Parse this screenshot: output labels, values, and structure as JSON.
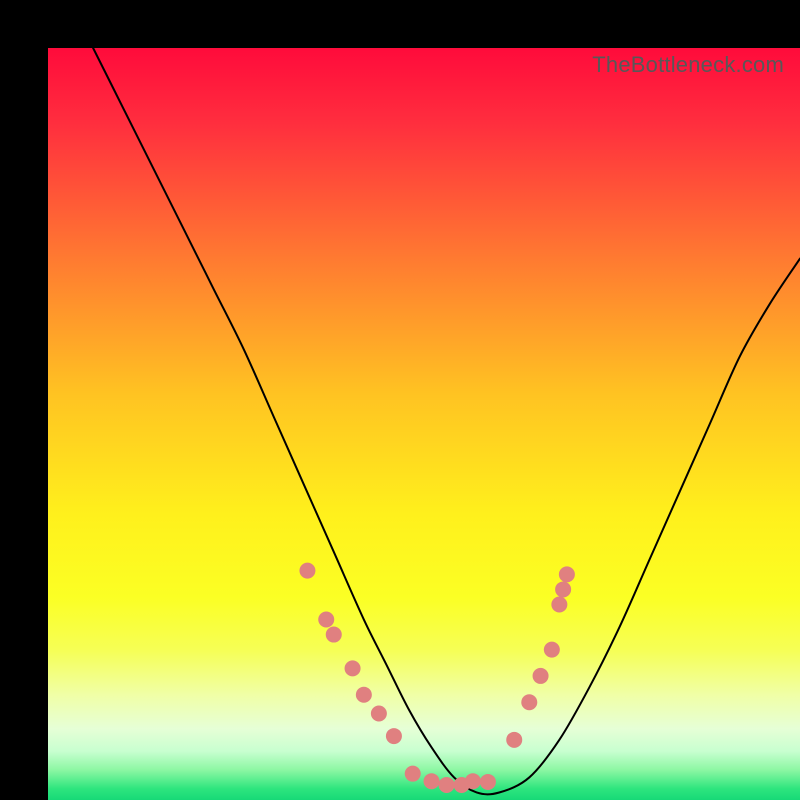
{
  "watermark": "TheBottleneck.com",
  "chart_data": {
    "type": "line",
    "title": "",
    "xlabel": "",
    "ylabel": "",
    "xlim": [
      0,
      100
    ],
    "ylim": [
      0,
      100
    ],
    "grid": false,
    "legend": false,
    "background": {
      "type": "vertical-gradient",
      "stops": [
        {
          "pos": 0.0,
          "color": "#ff0b3b"
        },
        {
          "pos": 0.1,
          "color": "#ff2e3e"
        },
        {
          "pos": 0.28,
          "color": "#ff7a31"
        },
        {
          "pos": 0.46,
          "color": "#ffc322"
        },
        {
          "pos": 0.62,
          "color": "#fff01c"
        },
        {
          "pos": 0.73,
          "color": "#fbff24"
        },
        {
          "pos": 0.8,
          "color": "#f6ff55"
        },
        {
          "pos": 0.86,
          "color": "#f0ffa6"
        },
        {
          "pos": 0.905,
          "color": "#e6ffd6"
        },
        {
          "pos": 0.935,
          "color": "#c8ffd0"
        },
        {
          "pos": 0.96,
          "color": "#8cf7a3"
        },
        {
          "pos": 0.985,
          "color": "#2ee57e"
        },
        {
          "pos": 1.0,
          "color": "#17d977"
        }
      ]
    },
    "series": [
      {
        "name": "bottleneck-curve",
        "color": "#000000",
        "width": 2,
        "x": [
          6,
          10,
          14,
          18,
          22,
          26,
          30,
          34,
          38,
          42,
          45,
          48,
          51,
          54,
          57,
          60,
          64,
          68,
          72,
          76,
          80,
          84,
          88,
          92,
          96,
          100
        ],
        "y": [
          100,
          92,
          84,
          76,
          68,
          60,
          51,
          42,
          33,
          24,
          18,
          12,
          7,
          3,
          1,
          1,
          3,
          8,
          15,
          23,
          32,
          41,
          50,
          59,
          66,
          72
        ]
      }
    ],
    "scatter": [
      {
        "name": "left-branch-points",
        "color": "#e08080",
        "radius": 8,
        "points": [
          {
            "x": 34.5,
            "y": 30.5
          },
          {
            "x": 37.0,
            "y": 24.0
          },
          {
            "x": 38.0,
            "y": 22.0
          },
          {
            "x": 40.5,
            "y": 17.5
          },
          {
            "x": 42.0,
            "y": 14.0
          },
          {
            "x": 44.0,
            "y": 11.5
          },
          {
            "x": 46.0,
            "y": 8.5
          }
        ]
      },
      {
        "name": "bottom-flat-points",
        "color": "#e08080",
        "radius": 8,
        "points": [
          {
            "x": 48.5,
            "y": 3.5
          },
          {
            "x": 51.0,
            "y": 2.5
          },
          {
            "x": 53.0,
            "y": 2.0
          },
          {
            "x": 55.0,
            "y": 2.0
          },
          {
            "x": 56.5,
            "y": 2.5
          },
          {
            "x": 58.5,
            "y": 2.4
          }
        ]
      },
      {
        "name": "right-branch-points",
        "color": "#e08080",
        "radius": 8,
        "points": [
          {
            "x": 62.0,
            "y": 8.0
          },
          {
            "x": 64.0,
            "y": 13.0
          },
          {
            "x": 65.5,
            "y": 16.5
          },
          {
            "x": 67.0,
            "y": 20.0
          },
          {
            "x": 68.0,
            "y": 26.0
          },
          {
            "x": 68.5,
            "y": 28.0
          },
          {
            "x": 69.0,
            "y": 30.0
          }
        ]
      }
    ]
  }
}
